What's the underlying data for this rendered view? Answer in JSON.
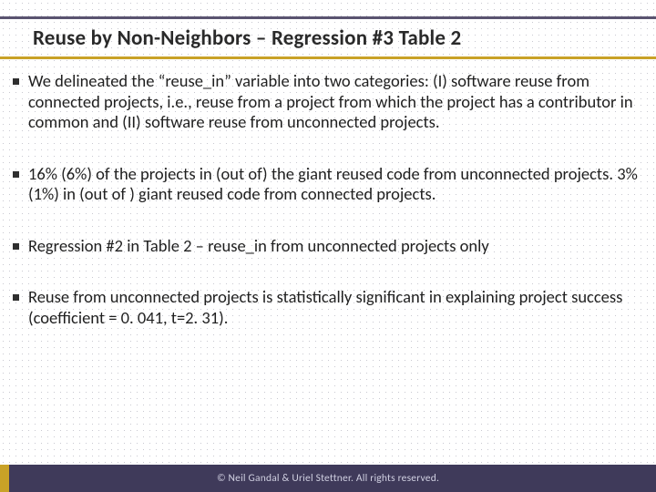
{
  "title": "Reuse by Non-Neighbors – Regression #3 Table 2",
  "bullets": [
    "We delineated the “reuse_in” variable into two categories: (I) software reuse from connected projects, i.e., reuse from a project from which the project has a contributor in common and (II) software reuse from unconnected projects.",
    "16% (6%) of the projects in (out of) the giant reused code from unconnected projects.  3% (1%) in (out of ) giant reused code from connected projects.",
    "Regression #2 in Table 2 – reuse_in from unconnected projects only",
    "Reuse from unconnected projects is statistically significant in explaining project success (coefficient = 0. 041, t=2. 31)."
  ],
  "footer": "© Neil Gandal & Uriel Stettner. All rights reserved."
}
